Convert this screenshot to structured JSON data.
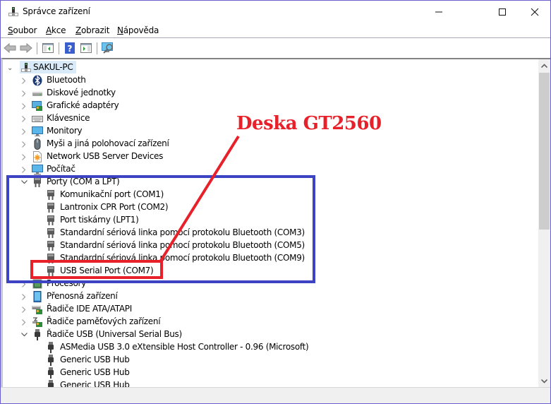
{
  "window": {
    "title": "Správce zařízení",
    "controls": {
      "minimize": "—",
      "maximize": "☐",
      "close": "✕"
    }
  },
  "menubar": {
    "items": [
      {
        "accel": "S",
        "rest": "oubor"
      },
      {
        "accel": "A",
        "rest": "kce"
      },
      {
        "accel": "Z",
        "rest": "obrazit"
      },
      {
        "accel": "N",
        "rest": "ápověda"
      }
    ]
  },
  "toolbar": {
    "buttons": [
      "back-icon",
      "forward-icon",
      "show-hide-console-tree-icon",
      "help-icon",
      "show-action-pane-icon",
      "scan-hardware-icon"
    ]
  },
  "tree": {
    "root": {
      "label": "SAKUL-PC",
      "expanded": true
    },
    "categories": [
      {
        "label": "Bluetooth",
        "icon": "bluetooth-icon",
        "expanded": false
      },
      {
        "label": "Diskové jednotky",
        "icon": "disk-drive-icon",
        "expanded": false
      },
      {
        "label": "Grafické adaptéry",
        "icon": "display-adapter-icon",
        "expanded": false
      },
      {
        "label": "Klávesnice",
        "icon": "keyboard-icon",
        "expanded": false
      },
      {
        "label": "Monitory",
        "icon": "monitor-icon",
        "expanded": false
      },
      {
        "label": "Myši a jiná polohovací zařízení",
        "icon": "mouse-icon",
        "expanded": false
      },
      {
        "label": "Network USB Server Devices",
        "icon": "network-usb-icon",
        "expanded": false
      },
      {
        "label": "Počítač",
        "icon": "computer-icon",
        "expanded": false
      },
      {
        "label": "Porty (COM a LPT)",
        "icon": "port-icon",
        "expanded": true,
        "children": [
          "Komunikační port (COM1)",
          "Lantronix CPR Port (COM2)",
          "Port tiskárny (LPT1)",
          "Standardní sériová linka pomocí protokolu Bluetooth (COM3)",
          "Standardní sériová linka pomocí protokolu Bluetooth (COM5)",
          "Standardní sériová linka pomocí protokolu Bluetooth (COM9)",
          "USB Serial Port (COM7)"
        ]
      },
      {
        "label": "Procesory",
        "icon": "processor-icon",
        "expanded": false
      },
      {
        "label": "Přenosná zařízení",
        "icon": "portable-device-icon",
        "expanded": false
      },
      {
        "label": "Řadiče IDE ATA/ATAPI",
        "icon": "ide-controller-icon",
        "expanded": false
      },
      {
        "label": "Řadiče paměťových zařízení",
        "icon": "storage-controller-icon",
        "expanded": false
      },
      {
        "label": "Řadiče USB (Universal Serial Bus)",
        "icon": "usb-icon",
        "expanded": true,
        "children": [
          "ASMedia USB 3.0 eXtensible Host Controller - 0.96 (Microsoft)",
          "Generic USB Hub",
          "Generic USB Hub",
          "Generic USB Hub"
        ]
      }
    ]
  },
  "annotation": {
    "label": "Deska GT2560",
    "color_red": "#e8202a",
    "color_blue": "#3c44c4"
  },
  "status": {
    "text": ""
  }
}
